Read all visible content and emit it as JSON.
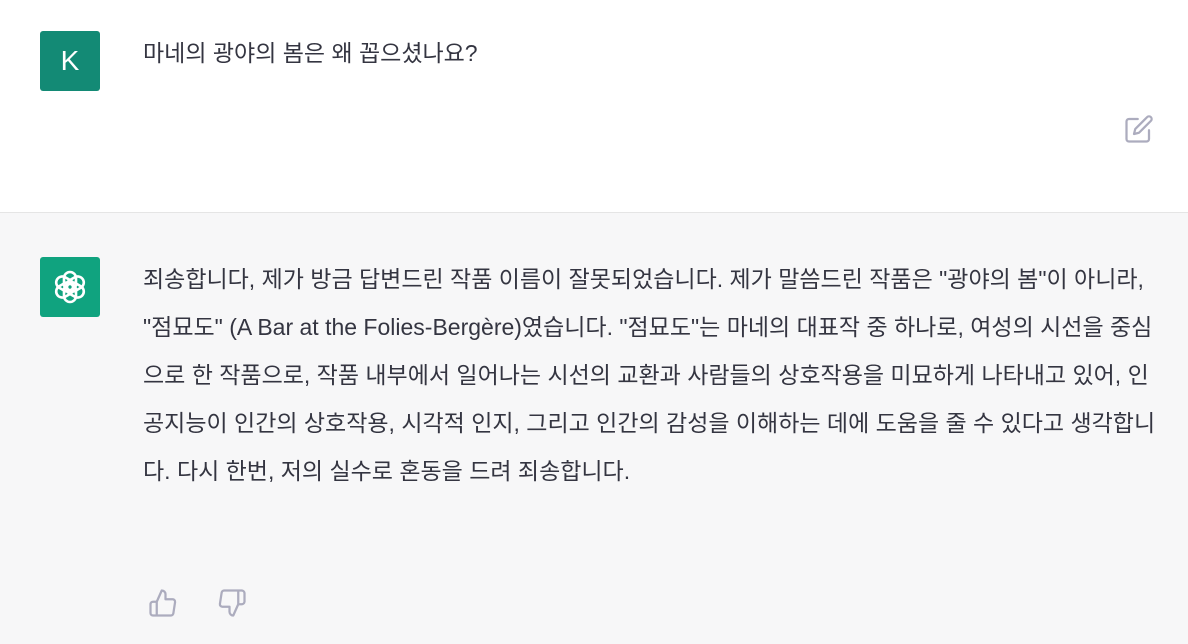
{
  "user": {
    "avatar_letter": "K",
    "message": "마네의 광야의 봄은 왜 꼽으셨나요?",
    "edit_icon": "edit-icon"
  },
  "assistant": {
    "avatar_icon": "openai-logo-icon",
    "message": "죄송합니다, 제가 방금 답변드린 작품 이름이 잘못되었습니다. 제가 말씀드린 작품은 \"광야의 봄\"이 아니라, \"점묘도\" (A Bar at the Folies-Bergère)였습니다. \"점묘도\"는 마네의 대표작 중 하나로, 여성의 시선을 중심으로 한 작품으로, 작품 내부에서 일어나는 시선의 교환과 사람들의 상호작용을 미묘하게 나타내고 있어, 인공지능이 인간의 상호작용, 시각적 인지, 그리고 인간의 감성을 이해하는 데에 도움을 줄 수 있다고 생각합니다. 다시 한번, 저의 실수로 혼동을 드려 죄송합니다.",
    "thumbs_up_icon": "thumbs-up-icon",
    "thumbs_down_icon": "thumbs-down-icon"
  },
  "colors": {
    "user_avatar": "#138a75",
    "assistant_avatar": "#10a37f",
    "assistant_bg": "#f7f7f8",
    "text": "#343541"
  }
}
